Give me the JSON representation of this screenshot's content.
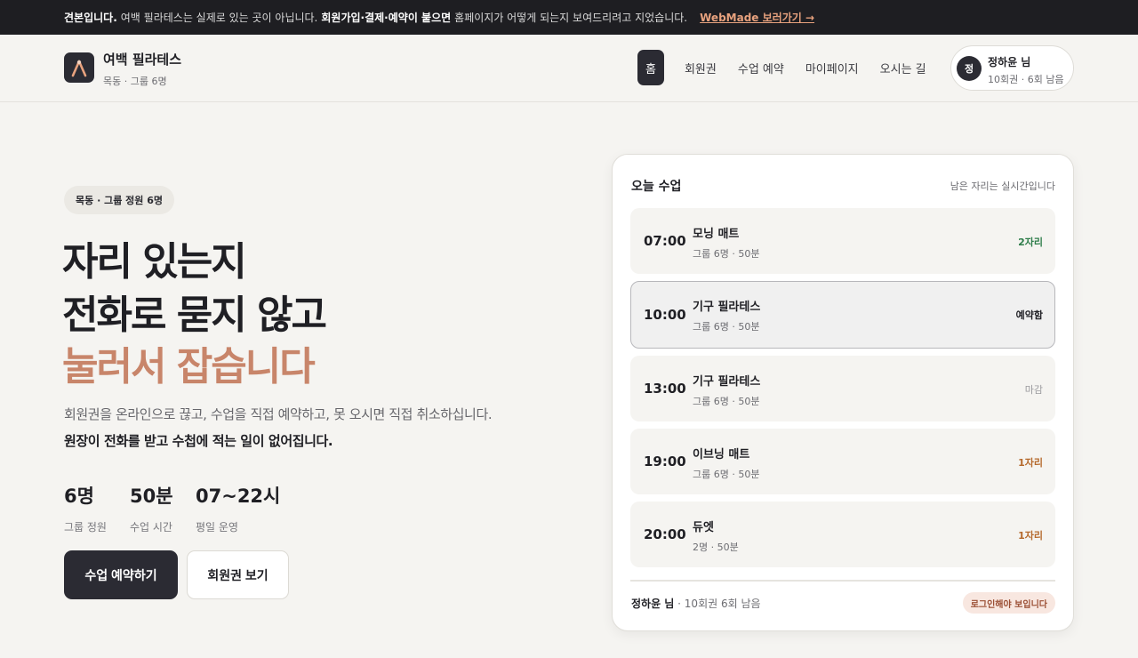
{
  "banner": {
    "lead": "견본입니다.",
    "text1": "여백 필라테스는 실제로 있는 곳이 아닙니다.",
    "bold2": "회원가입·결제·예약이 붙으면",
    "text2": "홈페이지가 어떻게 되는지 보여드리려고 지었습니다.",
    "link": "WebMade 보러가기 →"
  },
  "header": {
    "brand": "여백 필라테스",
    "brand_sub": "목동 · 그룹 6명",
    "nav": [
      "홈",
      "회원권",
      "수업 예약",
      "마이페이지",
      "오시는 길"
    ],
    "user": {
      "avatar": "정",
      "name": "정하윤 님",
      "remaining": "10회권 · 6회 남음"
    }
  },
  "hero": {
    "pill": "목동 · 그룹 정원 6명",
    "title_line1": "자리 있는지",
    "title_line2": "전화로 묻지 않고",
    "title_line3": "눌러서 잡습니다",
    "desc1": "회원권을 온라인으로 끊고, 수업을 직접 예약하고, 못 오시면 직접 취소하십니다.",
    "desc2": "원장이 전화를 받고 수첩에 적는 일이 없어집니다.",
    "stats": [
      {
        "value": "6명",
        "label": "그룹 정원"
      },
      {
        "value": "50분",
        "label": "수업 시간"
      },
      {
        "value": "07~22시",
        "label": "평일 운영"
      }
    ],
    "btn_primary": "수업 예약하기",
    "btn_secondary": "회원권 보기"
  },
  "schedule": {
    "title": "오늘 수업",
    "note": "남은 자리는 실시간입니다",
    "classes": [
      {
        "time": "07:00",
        "name": "모닝 매트",
        "meta": "그룹 6명 · 50분",
        "status": "2자리"
      },
      {
        "time": "10:00",
        "name": "기구 필라테스",
        "meta": "그룹 6명 · 50분",
        "status": "예약함"
      },
      {
        "time": "13:00",
        "name": "기구 필라테스",
        "meta": "그룹 6명 · 50분",
        "status": "마감"
      },
      {
        "time": "19:00",
        "name": "이브닝 매트",
        "meta": "그룹 6명 · 50분",
        "status": "1자리"
      },
      {
        "time": "20:00",
        "name": "듀엣",
        "meta": "2명 · 50분",
        "status": "1자리"
      }
    ],
    "footer_user": "정하윤 님",
    "footer_remaining": "· 10회권 6회 남음",
    "login_badge": "로그인해야 보입니다"
  },
  "colors": {
    "dark": "#2b2b33",
    "accent": "#c8856a",
    "available_green": "#2e7d4a",
    "available_brown": "#b5692c",
    "background": "#f5f4f1"
  }
}
